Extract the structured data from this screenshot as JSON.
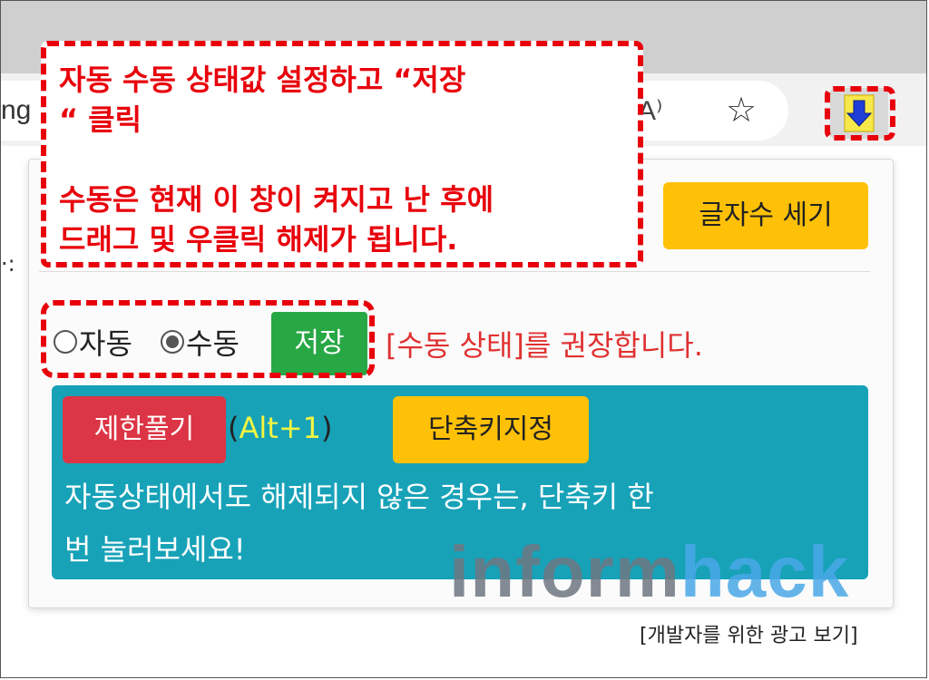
{
  "browser": {
    "url_fragment": "ng",
    "read_aloud_label": "A⁾",
    "favorite_icon": "star-icon",
    "extension_icon": "down-arrow-icon"
  },
  "callout": {
    "line1": "자동 수동 상태값 설정하고 “저장",
    "line2": "“ 클릭",
    "line3": "수동은 현재 이 창이 켜지고 난 후에",
    "line4": "드래그 및 우클릭 해제가 됩니다."
  },
  "popup": {
    "char_count_button": "글자수 세기",
    "mode": {
      "auto_label": "자동",
      "manual_label": "수동",
      "selected": "수동"
    },
    "save_button": "저장",
    "recommendation": "[수동 상태]를 권장합니다.",
    "unlock_button": "제한풀기",
    "shortcut_open": "(",
    "shortcut_key": "Alt+1",
    "shortcut_close": ")",
    "shortcut_button": "단축키지정",
    "info_line1": "자동상태에서도 해제되지 않은 경우는, 단축키 한",
    "info_line2": "번 눌러보세요!",
    "developer_ad_link": "[개발자를 위한 광고 보기]"
  },
  "page": {
    "side_text": "·:"
  },
  "watermark": {
    "part1": "inform",
    "part2": "hack"
  },
  "colors": {
    "callout_red": "#e8000b",
    "yellow_button": "#ffc107",
    "green_button": "#28a745",
    "red_button": "#dc3545",
    "info_panel": "#17a2b8",
    "recommend_text": "#e03131"
  }
}
